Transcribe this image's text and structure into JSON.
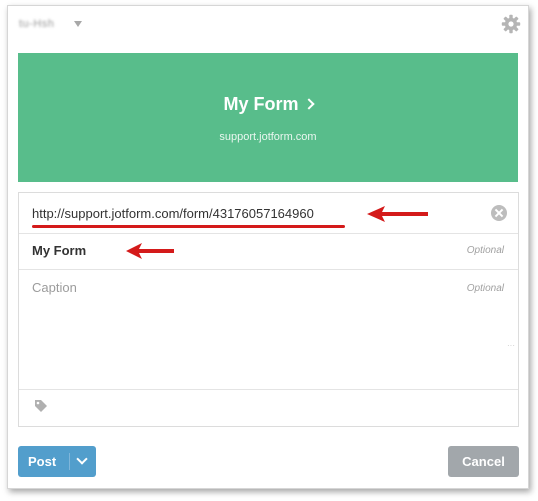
{
  "top_bar": {
    "account_name": "tu-Hsh",
    "icons": {
      "account_menu": "caret-down-icon",
      "settings": "gear-icon"
    }
  },
  "banner": {
    "title": "My Form",
    "subtitle": "support.jotform.com",
    "background_color": "#58bd8b"
  },
  "fields": {
    "url": "http://support.jotform.com/form/43176057164960",
    "title": "My Form",
    "title_hint": "Optional",
    "caption_placeholder": "Caption",
    "caption_hint": "Optional",
    "icons": {
      "clear": "close-circle-icon",
      "tags": "tag-icon"
    }
  },
  "annotations": {
    "color": "#d41a1a",
    "icon": "red-arrow-icon"
  },
  "actions": {
    "post_label": "Post",
    "post_color": "#529ecc",
    "cancel_label": "Cancel",
    "cancel_color": "#a2a7ab"
  }
}
